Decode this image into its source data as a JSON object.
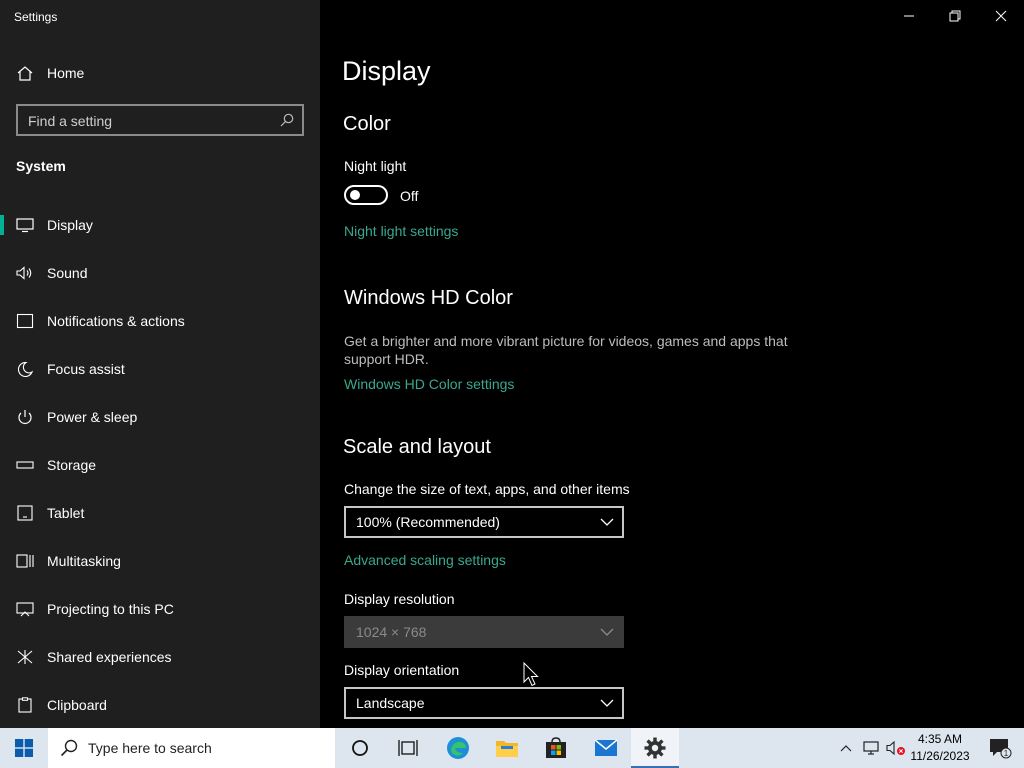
{
  "window": {
    "title": "Settings"
  },
  "sidebar": {
    "home_label": "Home",
    "search_placeholder": "Find a setting",
    "section": "System",
    "items": [
      {
        "label": "Display",
        "icon": "monitor-icon",
        "active": true
      },
      {
        "label": "Sound",
        "icon": "speaker-icon"
      },
      {
        "label": "Notifications & actions",
        "icon": "notification-icon"
      },
      {
        "label": "Focus assist",
        "icon": "moon-icon"
      },
      {
        "label": "Power & sleep",
        "icon": "power-icon"
      },
      {
        "label": "Storage",
        "icon": "storage-icon"
      },
      {
        "label": "Tablet",
        "icon": "tablet-icon"
      },
      {
        "label": "Multitasking",
        "icon": "multitasking-icon"
      },
      {
        "label": "Projecting to this PC",
        "icon": "projecting-icon"
      },
      {
        "label": "Shared experiences",
        "icon": "shared-icon"
      },
      {
        "label": "Clipboard",
        "icon": "clipboard-icon"
      }
    ]
  },
  "main": {
    "title": "Display",
    "color": {
      "heading": "Color",
      "night_light_label": "Night light",
      "night_light_state": "Off",
      "night_light_link": "Night light settings"
    },
    "hdr": {
      "heading": "Windows HD Color",
      "description": "Get a brighter and more vibrant picture for videos, games and apps that support HDR.",
      "link": "Windows HD Color settings"
    },
    "scale": {
      "heading": "Scale and layout",
      "size_label": "Change the size of text, apps, and other items",
      "size_value": "100% (Recommended)",
      "advanced_link": "Advanced scaling settings",
      "resolution_label": "Display resolution",
      "resolution_value": "1024 × 768",
      "orientation_label": "Display orientation",
      "orientation_value": "Landscape"
    }
  },
  "taskbar": {
    "search_placeholder": "Type here to search",
    "time": "4:35 AM",
    "date": "11/26/2023",
    "notification_count": "1"
  },
  "colors": {
    "accent": "#00b294",
    "link": "#3aa88f",
    "sidebar_bg": "#1f1f1f",
    "taskbar_bg": "#dde6ef"
  }
}
